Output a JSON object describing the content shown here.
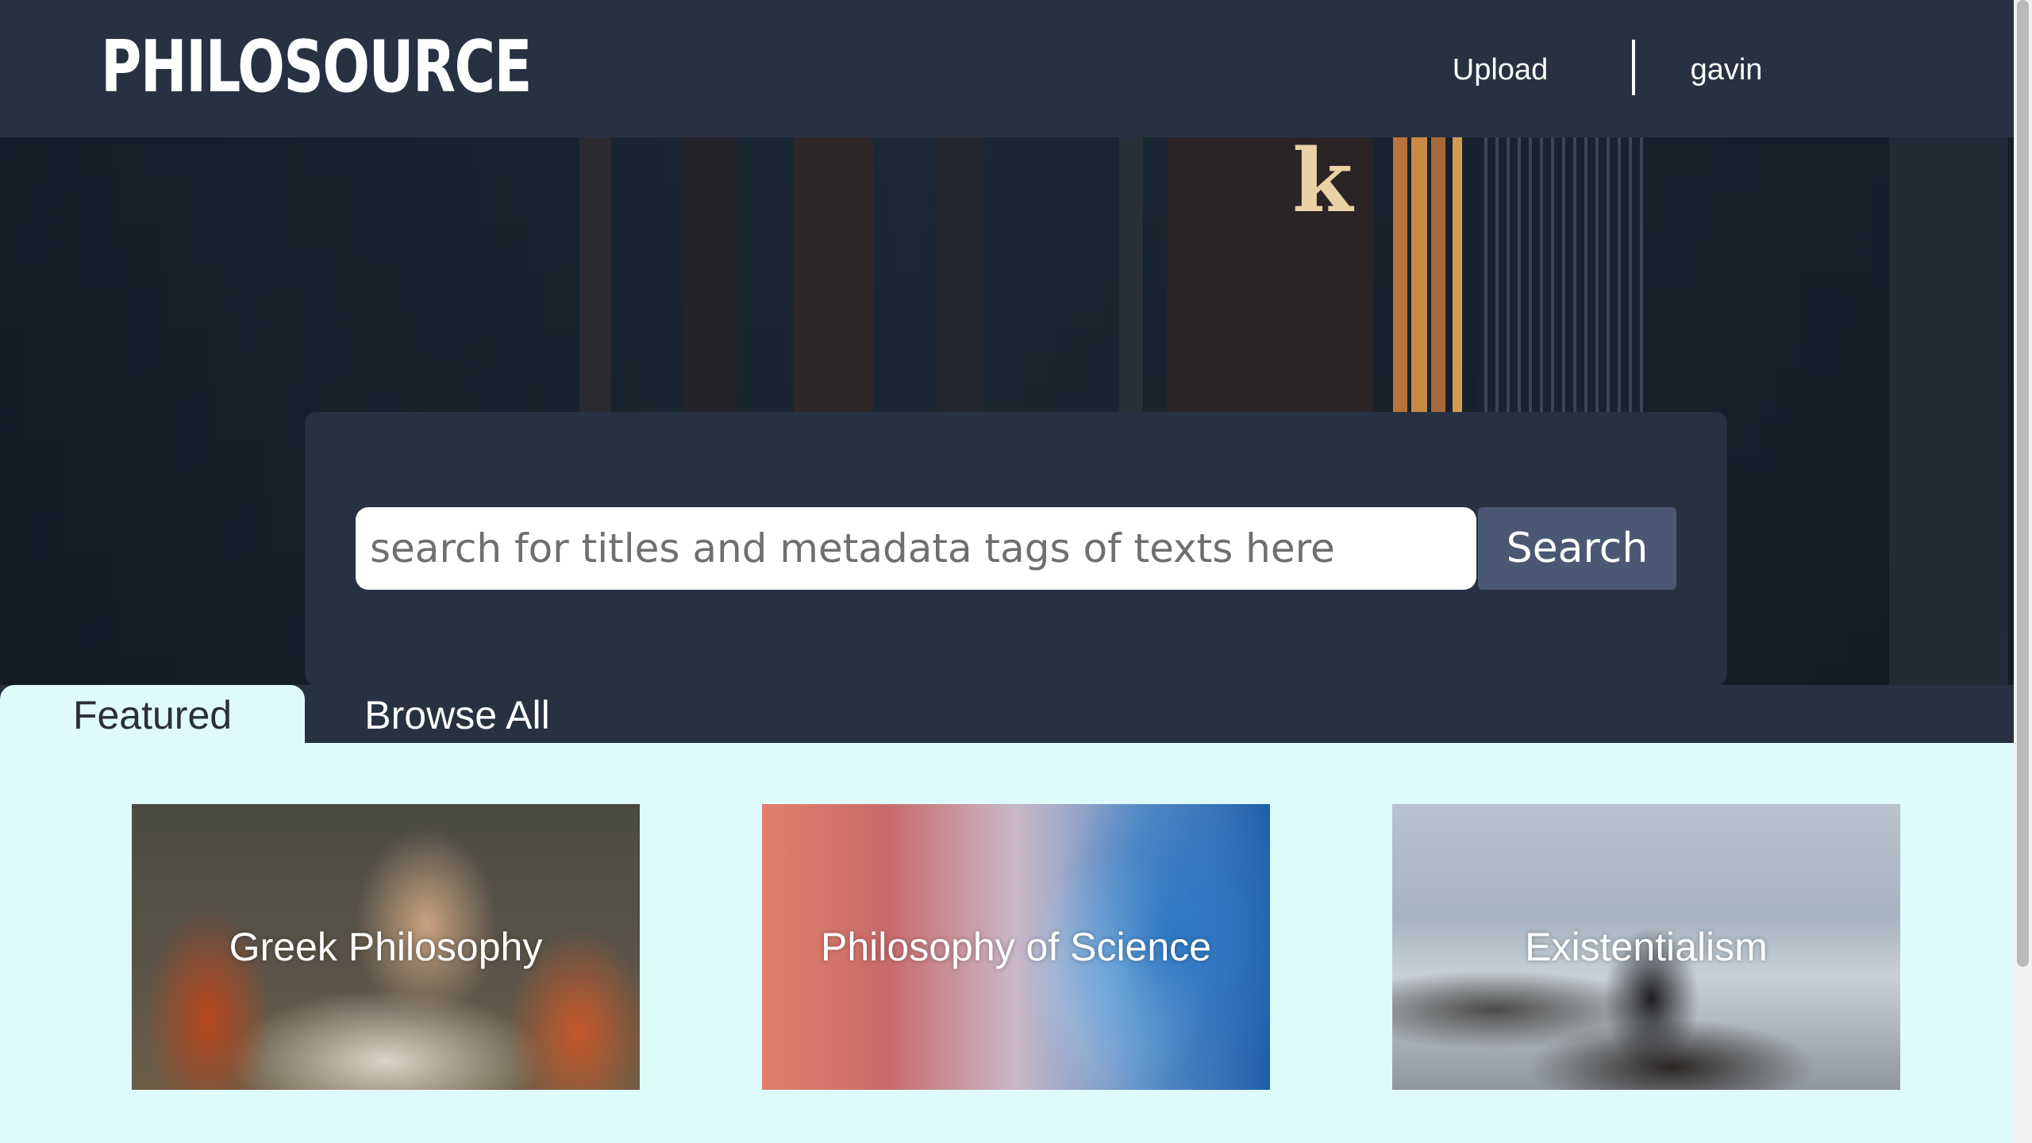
{
  "header": {
    "logo": "PHILOSOURCE",
    "upload_label": "Upload",
    "user_label": "gavin"
  },
  "search": {
    "placeholder": "search for titles and metadata tags of texts here",
    "button_label": "Search"
  },
  "tabs": [
    {
      "label": "Featured",
      "active": true
    },
    {
      "label": "Browse All",
      "active": false
    }
  ],
  "cards": [
    {
      "label": "Greek Philosophy"
    },
    {
      "label": "Philosophy of Science"
    },
    {
      "label": "Existentialism"
    }
  ],
  "colors": {
    "header_bg": "#283142",
    "page_bg": "#dffafb",
    "search_button": "#4b5873"
  }
}
